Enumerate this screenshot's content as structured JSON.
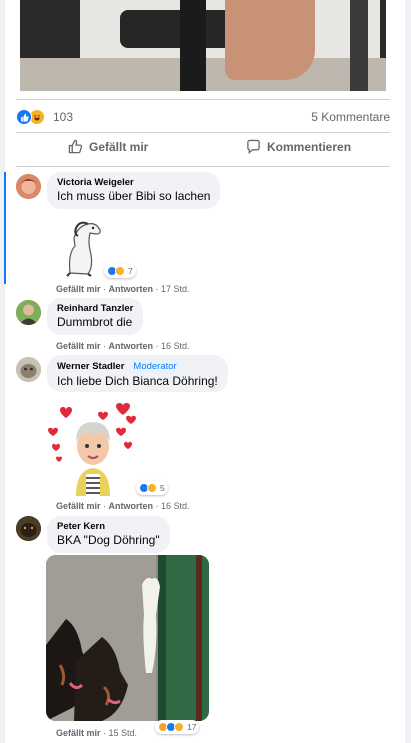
{
  "colors": {
    "accent": "#1877f2",
    "bubble": "#f0f2f5",
    "muted": "#65676b",
    "haha": "#f7b125"
  },
  "post": {
    "image_alt_icon": "post-photo"
  },
  "stats": {
    "reaction_count": "103",
    "comments": "5 Kommentare"
  },
  "actions": {
    "like": "Gefällt mir",
    "comment": "Kommentieren"
  },
  "comments": [
    {
      "author": "Victoria Weigeler",
      "text": "Ich muss über Bibi so lachen",
      "sticker": "horse-sticker",
      "reactions": "7",
      "meta": {
        "like": "Gefällt mir",
        "reply": "Antworten",
        "time": "17 Std."
      }
    },
    {
      "author": "Reinhard Tanzler",
      "text": "Dummbrot die",
      "meta": {
        "like": "Gefällt mir",
        "reply": "Antworten",
        "time": "16 Std."
      }
    },
    {
      "author": "Werner Stadler",
      "badge": "Moderator",
      "text": "Ich liebe Dich Bianca Döhring!",
      "sticker": "hearts-avatar-sticker",
      "reactions": "5",
      "meta": {
        "like": "Gefällt mir",
        "reply": "Antworten",
        "time": "16 Std."
      }
    },
    {
      "author": "Peter Kern",
      "text": "BKA \"Dog Döhring\"",
      "reactions": "17",
      "meta": {
        "like": "Gefällt mir",
        "time": "15 Std."
      }
    }
  ]
}
